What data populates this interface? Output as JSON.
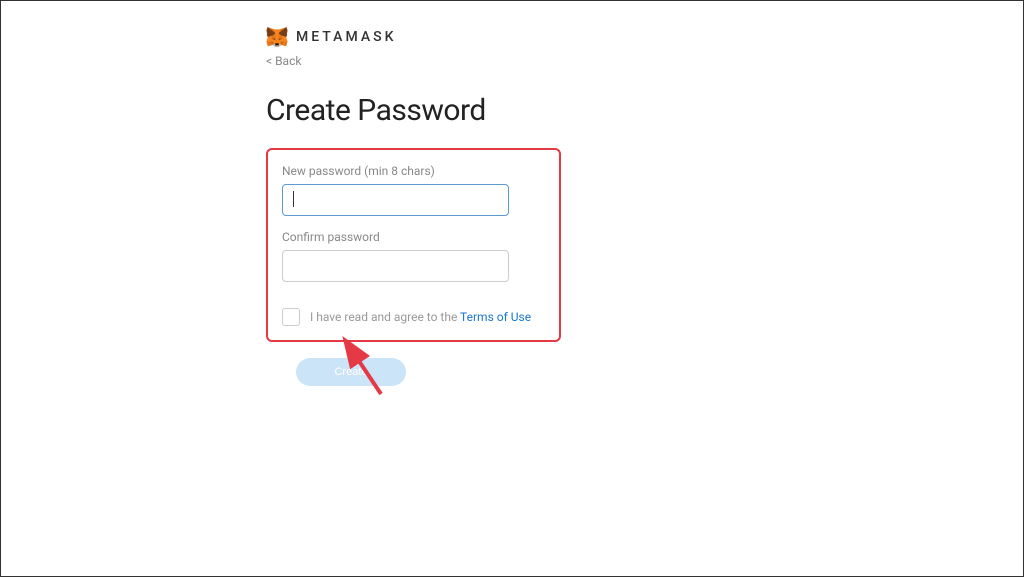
{
  "brand": {
    "name": "METAMASK"
  },
  "nav": {
    "back": "< Back"
  },
  "page": {
    "title": "Create Password"
  },
  "form": {
    "newPassword": {
      "label": "New password (min 8 chars)",
      "value": ""
    },
    "confirmPassword": {
      "label": "Confirm password",
      "value": ""
    },
    "terms": {
      "prefix": "I have read and agree to the ",
      "linkText": "Terms of Use"
    },
    "submitLabel": "Create"
  }
}
